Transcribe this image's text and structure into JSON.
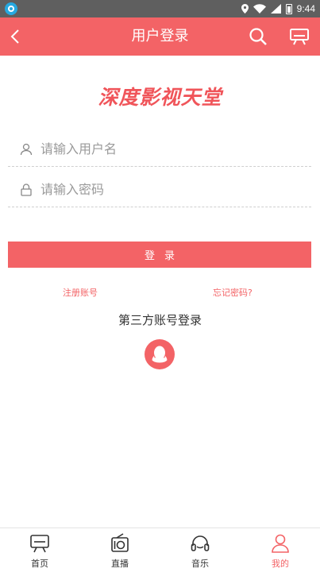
{
  "status_bar": {
    "time": "9:44"
  },
  "header": {
    "title": "用户登录"
  },
  "logo": {
    "text": "深度影视天堂"
  },
  "form": {
    "username_placeholder": "请输入用户名",
    "password_placeholder": "请输入密码",
    "login_label": "登录"
  },
  "links": {
    "register": "注册账号",
    "forgot": "忘记密码?"
  },
  "third_party": {
    "title": "第三方账号登录"
  },
  "bottom_nav": {
    "items": [
      {
        "label": "首页",
        "icon": "tv-icon"
      },
      {
        "label": "直播",
        "icon": "radio-icon"
      },
      {
        "label": "音乐",
        "icon": "headphones-icon"
      },
      {
        "label": "我的",
        "icon": "user-icon"
      }
    ],
    "active_index": 3
  },
  "colors": {
    "accent": "#f36366",
    "status_bar": "#5f5f5f"
  }
}
